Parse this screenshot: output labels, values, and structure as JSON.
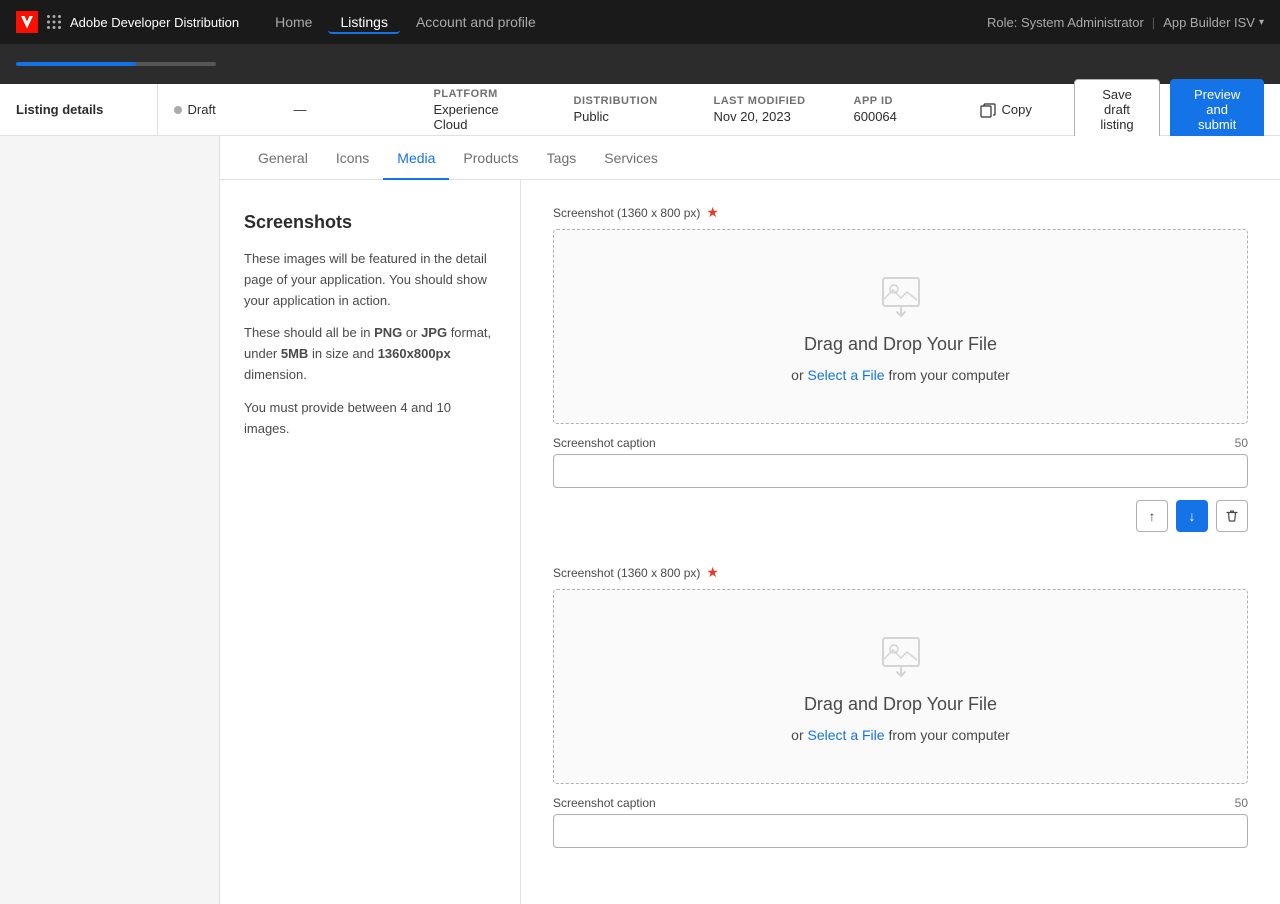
{
  "app": {
    "title": "Adobe Developer Distribution"
  },
  "topnav": {
    "brand": "Adobe Developer Distribution",
    "links": [
      {
        "label": "Home",
        "active": false
      },
      {
        "label": "Listings",
        "active": true
      },
      {
        "label": "Account and profile",
        "active": false
      }
    ],
    "role": "Role: System Administrator",
    "separator": "|",
    "user": "App Builder ISV",
    "chevron": "▾"
  },
  "statusbar": {
    "listing_details_label": "Listing details",
    "status_dot_color": "#aaaaaa",
    "status": "Draft",
    "dash": "—",
    "platform_label": "PLATFORM",
    "platform_value": "Experience Cloud",
    "distribution_label": "DISTRIBUTION",
    "distribution_value": "Public",
    "last_modified_label": "LAST MODIFIED",
    "last_modified_value": "Nov 20, 2023",
    "app_id_label": "APP ID",
    "app_id_value": "600064",
    "copy_label": "Copy",
    "save_draft_label": "Save draft listing",
    "preview_label": "Preview and submit"
  },
  "tabs": [
    {
      "label": "General",
      "active": false
    },
    {
      "label": "Icons",
      "active": false
    },
    {
      "label": "Media",
      "active": true
    },
    {
      "label": "Products",
      "active": false
    },
    {
      "label": "Tags",
      "active": false
    },
    {
      "label": "Services",
      "active": false
    }
  ],
  "screenshots": {
    "title": "Screenshots",
    "desc1": "These images will be featured in the detail page of your application. You should show your application in action.",
    "desc2_prefix": "These should all be in ",
    "desc2_png": "PNG",
    "desc2_or": " or ",
    "desc2_jpg": "JPG",
    "desc2_mid": " format, under ",
    "desc2_size": "5MB",
    "desc2_suffix": " in size and ",
    "desc2_dim": "1360x800px",
    "desc2_end": " dimension.",
    "desc3": "You must provide between 4 and 10 images.",
    "screenshot1": {
      "label": "Screenshot (1360 x 800 px)",
      "required": true,
      "drop_text": "Drag and Drop Your File",
      "drop_sub_prefix": "or ",
      "drop_sub_link": "Select a File",
      "drop_sub_suffix": " from your computer",
      "caption_label": "Screenshot caption",
      "caption_count": 50,
      "caption_value": ""
    },
    "screenshot2": {
      "label": "Screenshot (1360 x 800 px)",
      "required": true,
      "drop_text": "Drag and Drop Your File",
      "drop_sub_prefix": "or ",
      "drop_sub_link": "Select a File",
      "drop_sub_suffix": " from your computer",
      "caption_label": "Screenshot caption",
      "caption_count": 50,
      "caption_value": ""
    }
  },
  "buttons": {
    "up_arrow": "↑",
    "down_arrow": "↓",
    "trash": "🗑"
  }
}
